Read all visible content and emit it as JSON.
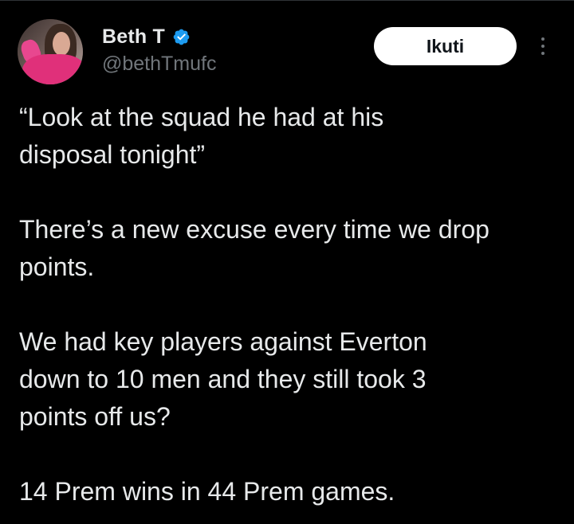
{
  "author": {
    "display_name": "Beth T",
    "handle": "@bethTmufc",
    "verified": true,
    "verified_color": "#1d9bf0"
  },
  "actions": {
    "follow_label": "Ikuti",
    "more_icon": "more-vertical-icon"
  },
  "tweet": {
    "paragraphs": [
      [
        "“Look at the squad he had at his",
        "disposal tonight”"
      ],
      [
        "There’s a new excuse every time we drop",
        "points."
      ],
      [
        "We had key players against Everton",
        "down to 10 men and they still took 3",
        "points off us?"
      ],
      [
        "14 Prem wins in 44 Prem games."
      ]
    ]
  },
  "colors": {
    "background": "#000000",
    "text_primary": "#e7e9ea",
    "text_secondary": "#71767b",
    "button_bg": "#ffffff",
    "button_text": "#0f1419"
  }
}
